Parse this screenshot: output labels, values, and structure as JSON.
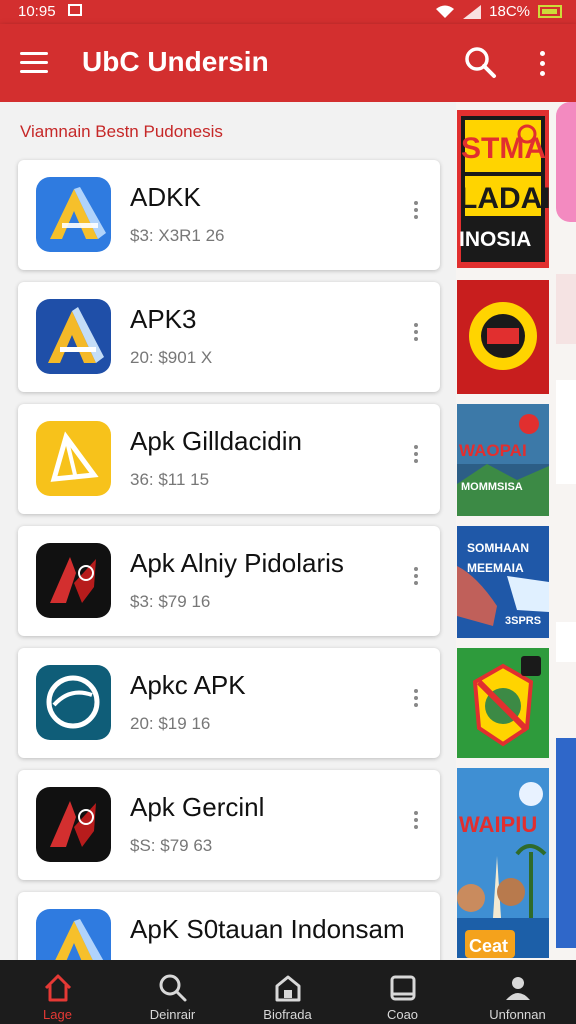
{
  "status_bar": {
    "time": "10:95",
    "battery": "18C%"
  },
  "app_bar": {
    "title": "UbC Undersin"
  },
  "section_title": "Viamnain Bestn Pudonesis",
  "apps": [
    {
      "name": "ADKK",
      "meta": "$3: X3R1 26",
      "icon": "blue-a-icon"
    },
    {
      "name": "APK3",
      "meta": "20: $901 X",
      "icon": "blue-a-icon"
    },
    {
      "name": "Apk Gilldacidin",
      "meta": "36: $11 15",
      "icon": "yellow-triangle-icon"
    },
    {
      "name": "Apk Alniy Pidolaris",
      "meta": "$3: $79 16",
      "icon": "black-red-icon"
    },
    {
      "name": "Apkc APK",
      "meta": "20: $19 16",
      "icon": "teal-circle-icon"
    },
    {
      "name": "Apk Gercinl",
      "meta": "$S: $79 63",
      "icon": "black-red-icon"
    },
    {
      "name": "ApK S0tauan Indonsam",
      "meta": "",
      "icon": "blue-a-icon"
    }
  ],
  "banners": [
    {
      "line1": "STMAI",
      "line2": "LADAI",
      "line3": "INOSIA"
    },
    {
      "label": ""
    },
    {
      "line1": "WAOPAI",
      "line2": "MOMMSISA"
    },
    {
      "line1": "SOMHAAN",
      "line2": "MEEMAIA",
      "line3": "3SPRS"
    },
    {
      "label": ""
    },
    {
      "line1": "WAIPIU",
      "line2": "Ceat"
    }
  ],
  "bottom_nav": [
    {
      "label": "Lage",
      "icon": "home-icon",
      "active": true
    },
    {
      "label": "Deinrair",
      "icon": "search-icon",
      "active": false
    },
    {
      "label": "Biofrada",
      "icon": "house-icon",
      "active": false
    },
    {
      "label": "Coao",
      "icon": "square-icon",
      "active": false
    },
    {
      "label": "Unfonnan",
      "icon": "person-icon",
      "active": false
    }
  ],
  "colors": {
    "primary": "#d32f2f",
    "nav_bg": "#1c1c1c",
    "active": "#e53935"
  }
}
